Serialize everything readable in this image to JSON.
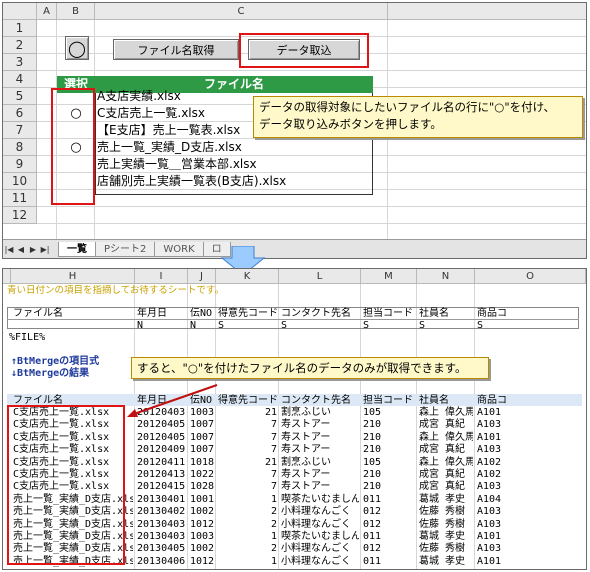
{
  "top_sheet": {
    "col_headers": [
      "A",
      "B",
      "C"
    ],
    "row_numbers": [
      "1",
      "2",
      "3",
      "4",
      "5",
      "6",
      "7",
      "8",
      "9",
      "10",
      "11",
      "12"
    ],
    "shape_symbol": "◯",
    "btn_filename": "ファイル名取得",
    "btn_import": "データ取込",
    "header_select": "選択",
    "header_filename": "ファイル名",
    "rows": [
      {
        "mark": "",
        "file": "A支店実績.xlsx"
      },
      {
        "mark": "○",
        "file": "C支店売上一覧.xlsx"
      },
      {
        "mark": "",
        "file": "【E支店】売上一覧表.xlsx"
      },
      {
        "mark": "○",
        "file": "売上一覧_実績_D支店.xlsx"
      },
      {
        "mark": "",
        "file": "売上実績一覧＿営業本部.xlsx"
      },
      {
        "mark": "",
        "file": "店舗別売上実績一覧表(B支店).xlsx"
      }
    ],
    "callout": [
      "データの取得対象にしたいファイル名の行に\"○\"を付け、",
      "データ取り込みボタンを押します。"
    ],
    "tabs": [
      "一覧",
      "Pシート2",
      "WORK",
      "ロ"
    ]
  },
  "bottom_sheet": {
    "col_headers": [
      "H",
      "I",
      "J",
      "K",
      "L",
      "M",
      "N",
      "O"
    ],
    "yellow_note": "青い日付ンの項目を指摘してお待するシートです。",
    "def_headers": [
      "ファイル名",
      "年月日",
      "伝NO",
      "得意先コード",
      "コンタクト先名",
      "担当コード",
      "社員名",
      "商品コ"
    ],
    "def_types": [
      "",
      "N",
      "N",
      "S",
      "S",
      "S",
      "S",
      "S"
    ],
    "filex": "%FILE%",
    "note1": "↑BtMergeの項目式",
    "note2": "↓BtMergeの結果",
    "callout": "すると、\"○\"を付けたファイル名のデータのみが取得できます。",
    "result_headers": [
      "ファイル名",
      "年月日",
      "伝NO",
      "得意先コード",
      "コンタクト先名",
      "担当コード",
      "社員名",
      "商品コ"
    ],
    "result_rows": [
      [
        "C支店売上一覧.xlsx",
        "20120403",
        "1003",
        "21",
        "割烹ふじい",
        "105",
        "森上 偉久馬",
        "A101"
      ],
      [
        "C支店売上一覧.xlsx",
        "20120405",
        "1007",
        "7",
        "寿ストアー",
        "210",
        "成宮 真紀",
        "A103"
      ],
      [
        "C支店売上一覧.xlsx",
        "20120405",
        "1007",
        "7",
        "寿ストアー",
        "210",
        "森上 偉久馬",
        "A101"
      ],
      [
        "C支店売上一覧.xlsx",
        "20120409",
        "1007",
        "7",
        "寿ストアー",
        "210",
        "成宮 真紀",
        "A103"
      ],
      [
        "C支店売上一覧.xlsx",
        "20120411",
        "1018",
        "21",
        "割烹ふじい",
        "105",
        "森上 偉久馬",
        "A102"
      ],
      [
        "C支店売上一覧.xlsx",
        "20120413",
        "1022",
        "7",
        "寿ストアー",
        "210",
        "成宮 真紀",
        "A102"
      ],
      [
        "C支店売上一覧.xlsx",
        "20120415",
        "1028",
        "7",
        "寿ストアー",
        "210",
        "成宮 真紀",
        "A103"
      ],
      [
        "売上一覧_実績_D支店.xlsx",
        "20130401",
        "1001",
        "1",
        "喫茶たいむましん",
        "011",
        "葛城 孝史",
        "A104"
      ],
      [
        "売上一覧_実績_D支店.xlsx",
        "20130402",
        "1002",
        "2",
        "小料理なんごく",
        "012",
        "佐藤 秀樹",
        "A103"
      ],
      [
        "売上一覧_実績_D支店.xlsx",
        "20130403",
        "1012",
        "2",
        "小料理なんごく",
        "012",
        "佐藤 秀樹",
        "A103"
      ],
      [
        "売上一覧_実績_D支店.xlsx",
        "20130403",
        "1003",
        "1",
        "喫茶たいむましん",
        "011",
        "葛城 孝史",
        "A101"
      ],
      [
        "売上一覧_実績_D支店.xlsx",
        "20130405",
        "1002",
        "2",
        "小料理なんごく",
        "012",
        "佐藤 秀樹",
        "A103"
      ],
      [
        "売上一覧_実績_D支店.xlsx",
        "20130406",
        "1012",
        "1",
        "小料理なんごく",
        "011",
        "葛城 孝史",
        "A101"
      ]
    ]
  },
  "colors": {
    "green_header": "#2e9a46",
    "red_box": "#e01414",
    "callout_bg": "#fff8c8",
    "arrow": "#7cb7ff"
  }
}
